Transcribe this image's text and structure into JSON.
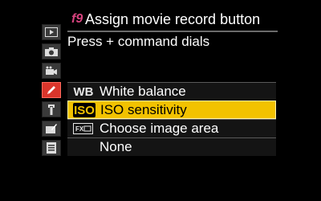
{
  "header": {
    "code": "f9",
    "title": "Assign movie record button"
  },
  "subtitle": "Press + command dials",
  "menu_tabs": [
    {
      "icon": "playback-icon",
      "active": false
    },
    {
      "icon": "camera-icon",
      "active": false
    },
    {
      "icon": "movie-camera-icon",
      "active": false
    },
    {
      "icon": "pencil-icon",
      "active": true
    },
    {
      "icon": "wrench-icon",
      "active": false
    },
    {
      "icon": "retouch-icon",
      "active": false
    },
    {
      "icon": "my-menu-icon",
      "active": false
    }
  ],
  "options": [
    {
      "badge": "WB",
      "label": "White balance",
      "selected": false
    },
    {
      "badge": "ISO",
      "label": "ISO sensitivity",
      "selected": true
    },
    {
      "badge": "FX",
      "label": "Choose image area",
      "selected": false
    },
    {
      "badge": "",
      "label": "None",
      "selected": false
    }
  ],
  "colors": {
    "accent_red": "#d9352b",
    "highlight_yellow": "#f2c200",
    "code_magenta": "#d6437e"
  }
}
